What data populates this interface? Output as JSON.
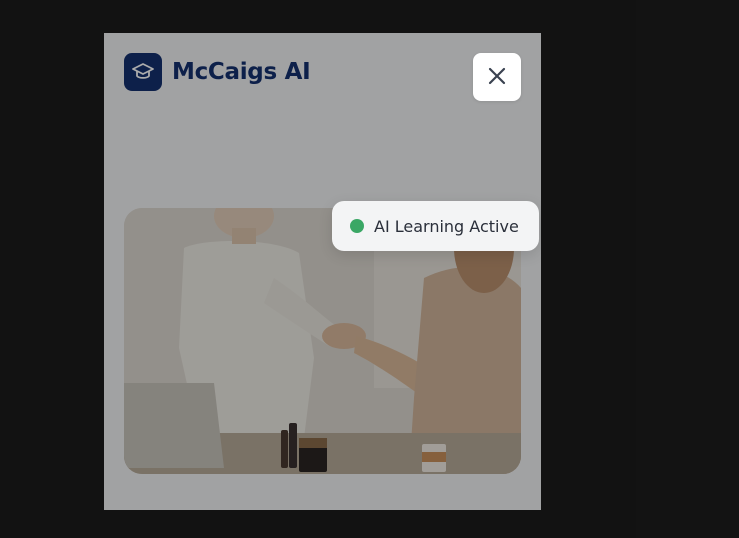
{
  "modal": {
    "brand": {
      "name": "McCaigs AI",
      "logo_icon": "graduation-cap-icon",
      "logo_color": "#14306f"
    },
    "close_icon": "close-icon",
    "status_badge": {
      "label": "AI Learning Active",
      "dot_color": "#3aa765"
    },
    "hero_image": {
      "subject": "handshake-photo"
    }
  },
  "colors": {
    "backdrop": "#1c1c1c",
    "panel": "#f1f2f4",
    "brand": "#14306f"
  }
}
